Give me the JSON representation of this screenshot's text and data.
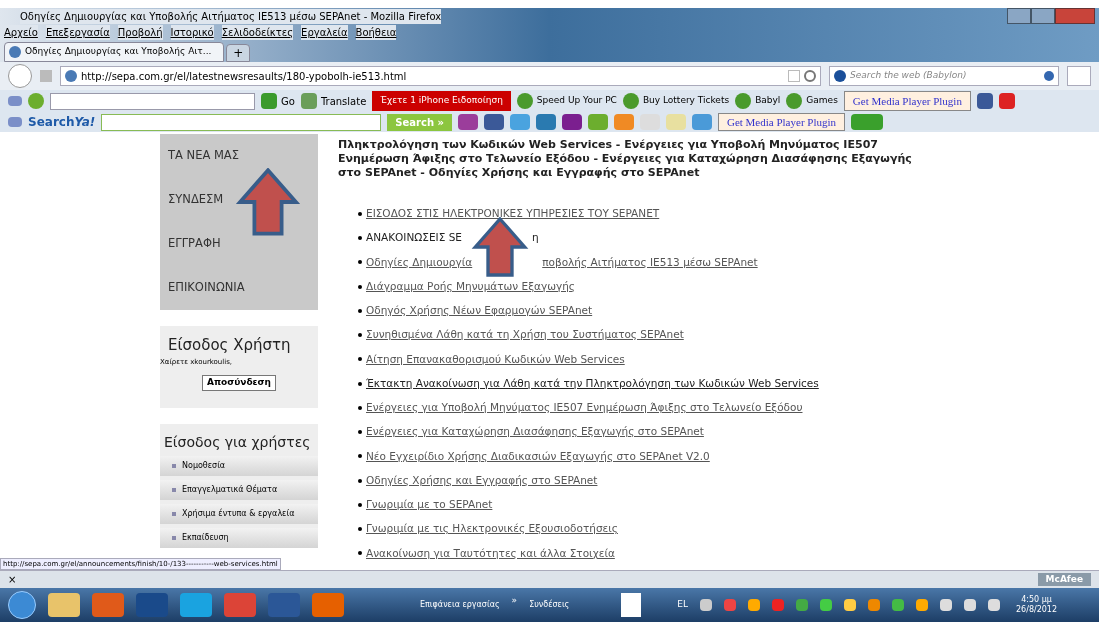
{
  "window": {
    "title": "Οδηγίες Δημιουργίας και Υποβολής Αιτήματος IE513 μέσω SEPAnet - Mozilla Firefox"
  },
  "menu": [
    "Αρχείο",
    "Επεξεργασία",
    "Προβολή",
    "Ιστορικό",
    "Σελιδοδείκτες",
    "Εργαλεία",
    "Βοήθεια"
  ],
  "tabs": [
    {
      "label": "Οδηγίες Δημιουργίας και Υποβολής Αιτ...",
      "selected": true
    }
  ],
  "new_tab": "+",
  "address": {
    "value": "http://sepa.com.gr/el/latestnewsresaults/180-ypobolh-ie513.html"
  },
  "web_search": {
    "placeholder": "Search the web (Babylon)"
  },
  "toolbar1": {
    "go": "Go",
    "translate": "Translate",
    "alert": "Έχετε 1 iPhone Ειδοποίηση",
    "links": [
      "Speed Up Your PC",
      "Buy Lottery Tickets",
      "Babyl",
      "Games"
    ],
    "plugin": "Get Media Player Plugin"
  },
  "toolbar2": {
    "logo_a": "Search",
    "logo_b": "Ya!",
    "search": "Search »",
    "plugin": "Get Media Player Plugin"
  },
  "sidebar": {
    "nav": [
      {
        "label": "ΤΑ ΝΕΑ ΜΑΣ"
      },
      {
        "label": "ΣΥΝΔΕΣΜ"
      },
      {
        "label": "ΕΓΓΡΑΦΗ"
      },
      {
        "label": "ΕΠΙΚΟΙΝΩΝΙΑ"
      }
    ],
    "login": {
      "title": "Είσοδος Χρήστη",
      "greeting": "Χαίρετε xkourkoulis,",
      "button": "Αποσύνδεση"
    },
    "users": {
      "title": "Είσοδος για χρήστες",
      "items": [
        "Νομοθεσία",
        "Επαγγελματικά Θέματα",
        "Χρήσιμα έντυπα & εργαλεία",
        "Εκπαίδευση"
      ]
    }
  },
  "heading": "Πληκτρολόγηση των Κωδικών Web Services - Ενέργειες για Υποβολή Μηνύματος IE507 Ενημέρωση Άφιξης στο Τελωνείο Εξόδου - Ενέργειες για Καταχώρηση Διασάφησης Εξαγωγής στο SEPAnet - Οδηγίες Χρήσης και Εγγραφής στο SEPAnet",
  "links": [
    {
      "kind": "link",
      "parts": [
        "ΕΙΣΟΔΟΣ ΣΤΙΣ ΗΛΕΚΤΡΟΝΙΚΕΣ ΥΠΗΡΕΣΙΕΣ ΤΟΥ SEPANET"
      ]
    },
    {
      "kind": "plain",
      "parts": [
        "ΑΝΑΚΟΙΝΩΣΕΙΣ SE",
        "η"
      ]
    },
    {
      "kind": "link",
      "parts": [
        "Οδηγίες Δημιουργία",
        "ποβολής Αιτήματος IE513 μέσω SEPAnet"
      ]
    },
    {
      "kind": "link",
      "parts": [
        "Διάγραμμα Ροής Μηνυμάτων Εξαγωγής"
      ]
    },
    {
      "kind": "link",
      "parts": [
        "Οδηγός Χρήσης Νέων Εφαρμογών SEPAnet"
      ]
    },
    {
      "kind": "link",
      "parts": [
        "Συνηθισμένα  Λάθη κατά τη Χρήση του Συστήματος SEPAnet"
      ]
    },
    {
      "kind": "link",
      "parts": [
        "Αίτηση Επανακαθορισμού Κωδικών Web Services"
      ]
    },
    {
      "kind": "visited",
      "parts": [
        "Έκτακτη Ανακοίνωση για Λάθη κατά την Πληκτρολόγηση των Κωδικών Web Services"
      ]
    },
    {
      "kind": "link",
      "parts": [
        "Ενέργειες για Υποβολή Μηνύματος IE507 Ενημέρωση Άφιξης στο Τελωνείο Εξόδου"
      ]
    },
    {
      "kind": "link",
      "parts": [
        "Ενέργειες για Καταχώρηση Διασάφησης Εξαγωγής στο SEPAnet"
      ]
    },
    {
      "kind": "link",
      "parts": [
        "Νέο Εγχειρίδιο Χρήσης Διαδικασιών Εξαγωγής στο SEPAnet V2.0"
      ]
    },
    {
      "kind": "link",
      "parts": [
        "Οδηγίες Χρήσης και Εγγραφής στο SEPAnet"
      ]
    },
    {
      "kind": "link",
      "parts": [
        "Γνωριμία με το SEPAnet"
      ]
    },
    {
      "kind": "link",
      "parts": [
        "Γνωριμία με τις Ηλεκτρονικές Εξουσιοδοτήσεις"
      ]
    },
    {
      "kind": "link",
      "parts": [
        "Ανακοίνωση για Ταυτότητες και άλλα Στοιχεία"
      ]
    }
  ],
  "status_url": "http://sepa.com.gr/el/announcements/finish/10-/133-----------web-services.html",
  "addon_bar": {
    "close": "×",
    "mcafee": "McAfee"
  },
  "taskbar": {
    "desktop": "Επιφάνεια εργασίας",
    "chevron": "»",
    "connections": "Συνδέσεις",
    "lang": "EL",
    "time": "4:50 μμ",
    "date": "26/8/2012"
  }
}
